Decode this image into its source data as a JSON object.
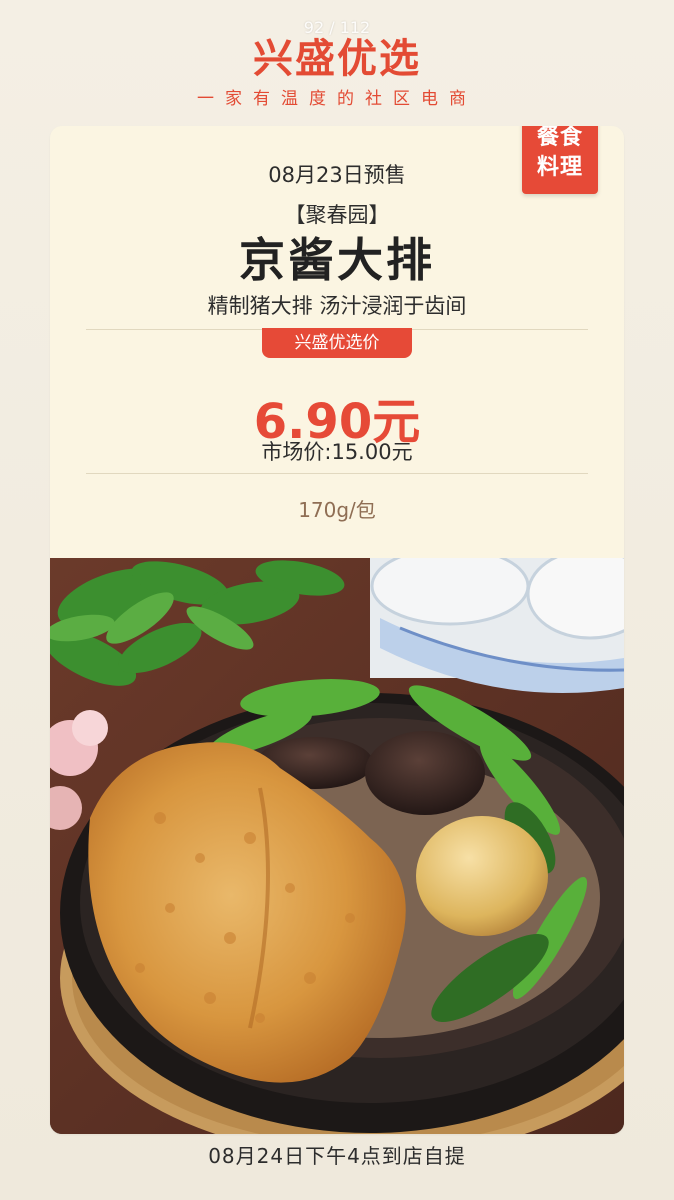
{
  "header": {
    "page_indicator": "92 / 112",
    "brand": "兴盛优选",
    "slogan": "一家有温度的社区电商"
  },
  "product": {
    "category": [
      "餐食",
      "料理"
    ],
    "presale_date": "08月23日预售",
    "brand_name": "【聚春园】",
    "title": "京酱大排",
    "subtitle": "精制猪大排 汤汁浸润于齿间",
    "price_label": "兴盛优选价",
    "price": "6.90元",
    "market_price": "市场价:15.00元",
    "weight": "170g/包"
  },
  "footer": {
    "pickup": "08月24日下午4点到店自提"
  },
  "colors": {
    "accent": "#e64a37",
    "background": "#f1ecdf",
    "card": "#fbf5e2"
  }
}
